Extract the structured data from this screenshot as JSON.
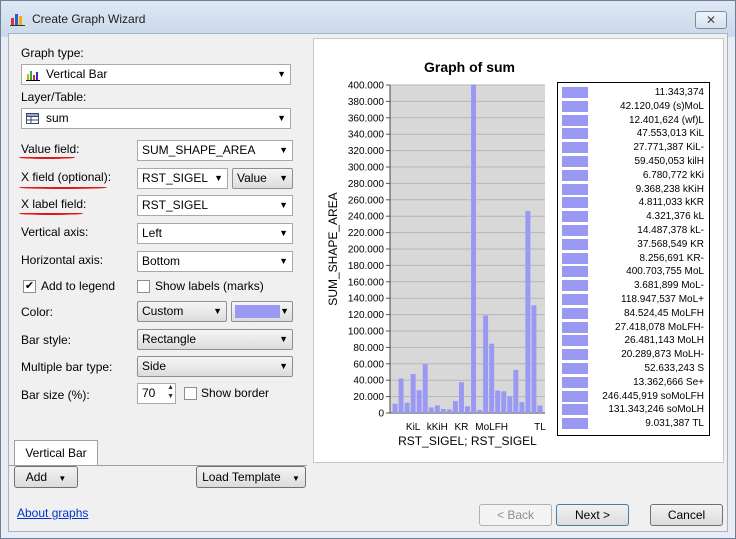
{
  "window": {
    "title": "Create Graph Wizard",
    "close_label": "✕"
  },
  "form": {
    "graph_type_label": "Graph type:",
    "graph_type_value": "Vertical Bar",
    "layer_label": "Layer/Table:",
    "layer_value": "sum",
    "value_field_label": "Value field:",
    "value_field_value": "SUM_SHAPE_AREA",
    "x_field_label": "X field (optional):",
    "x_field_value": "RST_SIGEL",
    "x_field_mode": "Value",
    "x_label_field_label": "X label field:",
    "x_label_field_value": "RST_SIGEL",
    "vertical_axis_label": "Vertical axis:",
    "vertical_axis_value": "Left",
    "horizontal_axis_label": "Horizontal axis:",
    "horizontal_axis_value": "Bottom",
    "add_to_legend_label": "Add to legend",
    "add_to_legend_checked": true,
    "show_labels_label": "Show labels (marks)",
    "show_labels_checked": false,
    "color_label": "Color:",
    "color_value": "Custom",
    "color_swatch": "#9999f4",
    "bar_style_label": "Bar style:",
    "bar_style_value": "Rectangle",
    "multiple_bar_type_label": "Multiple bar type:",
    "multiple_bar_type_value": "Side",
    "bar_size_label": "Bar size (%):",
    "bar_size_value": "70",
    "show_border_label": "Show border",
    "show_border_checked": false
  },
  "tabs": {
    "active": "Vertical Bar"
  },
  "buttons": {
    "add": "Add",
    "load_template": "Load Template",
    "back": "< Back",
    "next": "Next >",
    "cancel": "Cancel"
  },
  "links": {
    "about": "About graphs"
  },
  "colors": {
    "bar": "#9999f4",
    "plot_bg": "#d8d8d8",
    "annotation_red": "#e01818"
  },
  "chart_data": {
    "type": "bar",
    "title": "Graph of sum",
    "xlabel": "RST_SIGEL; RST_SIGEL",
    "ylabel": "SUM_SHAPE_AREA",
    "ylim": [
      0,
      400000
    ],
    "yticks": [
      "0",
      "20.000",
      "40.000",
      "60.000",
      "80.000",
      "100.000",
      "120.000",
      "140.000",
      "160.000",
      "180.000",
      "200.000",
      "220.000",
      "240.000",
      "260.000",
      "280.000",
      "300.000",
      "320.000",
      "340.000",
      "360.000",
      "380.000",
      "400.000"
    ],
    "xtick_labels": [
      "KiL",
      "kKiH",
      "KR",
      "MoLFH",
      "TL"
    ],
    "legend_position": "right",
    "grid": "horizontal",
    "series": [
      {
        "values": [
          11343,
          42120,
          12402,
          47553,
          27771,
          59450,
          6781,
          9368,
          4811,
          4321,
          14487,
          37569,
          8257,
          400704,
          3682,
          118948,
          84524,
          27418,
          26481,
          20290,
          52633,
          13363,
          246446,
          131343,
          9031
        ]
      }
    ],
    "legend_items": [
      "11.343,374",
      "42.120,049 (s)MoL",
      "12.401,624 (wf)L",
      "47.553,013 KiL",
      "27.771,387 KiL-",
      "59.450,053 kilH",
      "6.780,772 kKi",
      "9.368,238 kKiH",
      "4.811,033 kKR",
      "4.321,376 kL",
      "14.487,378 kL-",
      "37.568,549 KR",
      "8.256,691 KR-",
      "400.703,755 MoL",
      "3.681,899 MoL-",
      "118.947,537 MoL+",
      "84.524,45 MoLFH",
      "27.418,078 MoLFH-",
      "26.481,143 MoLH",
      "20.289,873 MoLH-",
      "52.633,243 S",
      "13.362,666 Se+",
      "246.445,919 soMoLFH",
      "131.343,246 soMoLH",
      "9.031,387 TL"
    ]
  }
}
